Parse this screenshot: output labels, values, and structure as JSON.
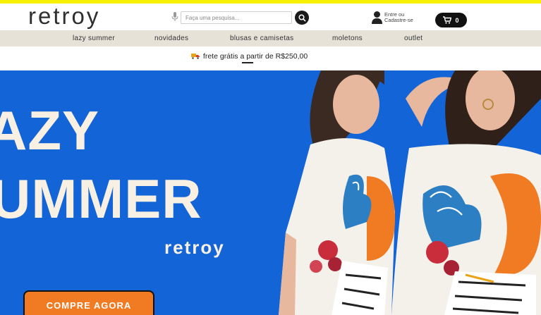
{
  "header": {
    "logo": "retroy",
    "search_placeholder": "Faça uma pesquisa...",
    "login_line1": "Entre ou",
    "login_line2": "Cadastre-se",
    "cart_count": "0"
  },
  "nav": {
    "items": [
      {
        "label": "lazy summer"
      },
      {
        "label": "novidades"
      },
      {
        "label": "blusas e camisetas"
      },
      {
        "label": "moletons"
      },
      {
        "label": "outlet"
      }
    ]
  },
  "shipping": {
    "text": "frete grátis a partir de R$250,00"
  },
  "hero": {
    "line1": "AZY",
    "line2": "UMMER",
    "brand": "retroy",
    "cta": "COMPRE AGORA"
  },
  "colors": {
    "top_accent": "#f6f000",
    "nav_bg": "#e6e2d8",
    "hero_blue": "#1364d6",
    "cta_orange": "#f07b23"
  }
}
